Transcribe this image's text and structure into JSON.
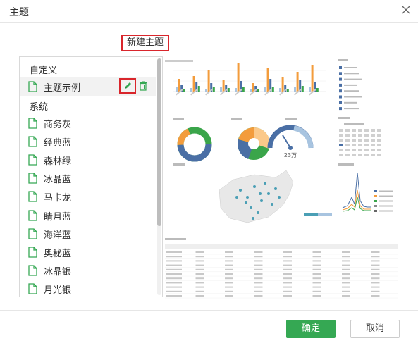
{
  "dialog": {
    "title": "主题",
    "new_theme_button": "新建主题",
    "ok_button": "确定",
    "cancel_button": "取消"
  },
  "themes": {
    "custom_section": "自定义",
    "custom_items": [
      {
        "label": "主题示例",
        "selected": true
      }
    ],
    "system_section": "系统",
    "system_items": [
      {
        "label": "商务灰"
      },
      {
        "label": "经典蓝"
      },
      {
        "label": "森林绿"
      },
      {
        "label": "冰晶蓝"
      },
      {
        "label": "马卡龙"
      },
      {
        "label": "睛月蓝"
      },
      {
        "label": "海洋蓝"
      },
      {
        "label": "奥秘蓝"
      },
      {
        "label": "冰晶银"
      },
      {
        "label": "月光银"
      }
    ]
  },
  "icons": {
    "close": "close-icon",
    "document": "document-icon",
    "edit": "pencil-icon",
    "delete": "trash-icon"
  },
  "colors": {
    "accent_green": "#35a853",
    "highlight_red": "#d9262c",
    "chart_blue": "#4a6fa5",
    "chart_orange": "#f39c3c",
    "chart_green": "#3aa54a",
    "chart_light": "#a8c4e0"
  },
  "preview": {
    "gauge_value": "23万"
  }
}
